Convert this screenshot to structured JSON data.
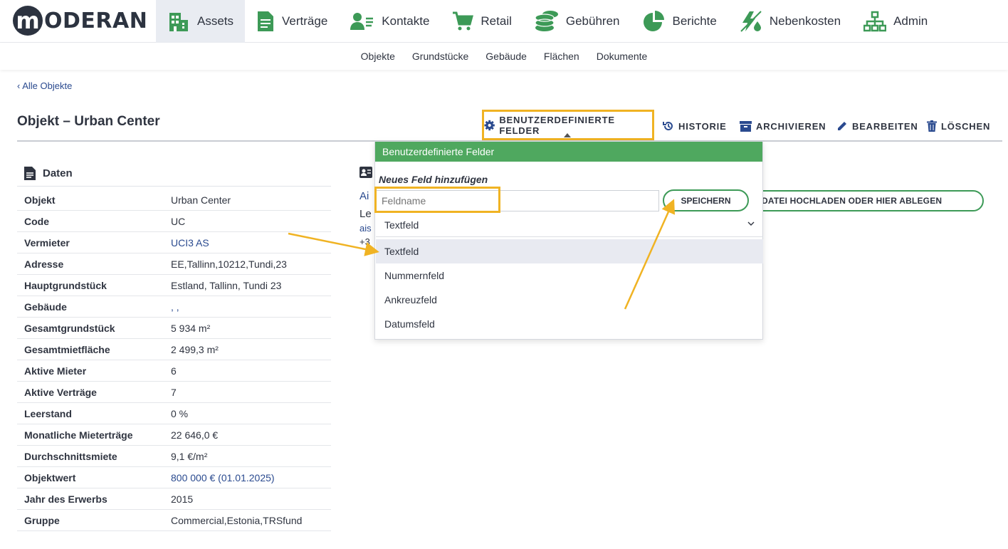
{
  "brand": {
    "logo_letter": "m",
    "logo_text": "ODERAN"
  },
  "nav": [
    {
      "label": "Assets",
      "icon": "building-icon"
    },
    {
      "label": "Verträge",
      "icon": "document-icon"
    },
    {
      "label": "Kontakte",
      "icon": "contacts-icon"
    },
    {
      "label": "Retail",
      "icon": "cart-icon"
    },
    {
      "label": "Gebühren",
      "icon": "coins-icon"
    },
    {
      "label": "Berichte",
      "icon": "pie-chart-icon"
    },
    {
      "label": "Nebenkosten",
      "icon": "utilities-icon"
    },
    {
      "label": "Admin",
      "icon": "org-chart-icon"
    }
  ],
  "subnav": [
    "Objekte",
    "Grundstücke",
    "Gebäude",
    "Flächen",
    "Dokumente"
  ],
  "back_link": "‹ Alle Objekte",
  "page_title": "Objekt – Urban Center",
  "actions": {
    "custom_fields": "BENUTZERDEFINIERTE FELDER",
    "history": "HISTORIE",
    "archive": "ARCHIVIEREN",
    "edit": "BEARBEITEN",
    "delete": "LÖSCHEN"
  },
  "data_section": {
    "title": "Daten",
    "rows": [
      {
        "label": "Objekt",
        "value": "Urban Center"
      },
      {
        "label": "Code",
        "value": "UC"
      },
      {
        "label": "Vermieter",
        "value": "UCI3 AS"
      },
      {
        "label": "Adresse",
        "value": "EE,Tallinn,10212,Tundi,23"
      },
      {
        "label": "Hauptgrundstück",
        "value": "Estland, Tallinn, Tundi 23"
      },
      {
        "label": "Gebäude",
        "value": ", ,"
      },
      {
        "label": "Gesamtgrundstück",
        "value": "5 934 m²"
      },
      {
        "label": "Gesamtmietfläche",
        "value": "2 499,3 m²"
      },
      {
        "label": "Aktive Mieter",
        "value": "6"
      },
      {
        "label": "Aktive Verträge",
        "value": "7"
      },
      {
        "label": "Leerstand",
        "value": "0 %"
      },
      {
        "label": "Monatliche Mieterträge",
        "value": "22 646,0 €"
      },
      {
        "label": "Durchschnittsmiete",
        "value": "9,1 €/m²"
      },
      {
        "label": "Objektwert",
        "value": "800 000 € (01.01.2025)"
      },
      {
        "label": "Jahr des Erwerbs",
        "value": "2015"
      },
      {
        "label": "Gruppe",
        "value": "Commercial,Estonia,TRSfund"
      }
    ]
  },
  "contact_partial": {
    "line1": "Ai",
    "line2": "Le",
    "line3": "ais",
    "line4": "+3"
  },
  "upload_button": "DATEI HOCHLADEN ODER HIER ABLEGEN",
  "popover": {
    "header": "Benutzerdefinierte Felder",
    "subtitle": "Neues Feld hinzufügen",
    "field_placeholder": "Feldname",
    "save_label": "SPEICHERN",
    "selected_type": "Textfeld",
    "options": [
      "Textfeld",
      "Nummernfeld",
      "Ankreuzfeld",
      "Datumsfeld"
    ]
  },
  "colors": {
    "highlight": "#f0b323",
    "accent_green": "#4fa85f",
    "link": "#2a4a8f"
  }
}
